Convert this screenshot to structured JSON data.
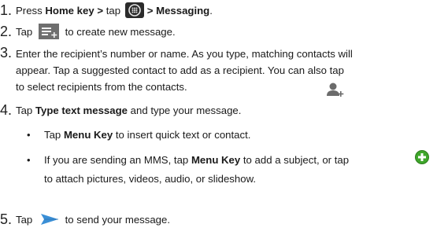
{
  "steps": [
    {
      "number": "1.",
      "parts": [
        "Press ",
        "Home key >",
        " tap ",
        "> Messaging",
        "."
      ]
    },
    {
      "number": "2.",
      "before": "Tap ",
      "after": " to create new message."
    },
    {
      "number": "3.",
      "lines": [
        "Enter the recipient’s number or name. As you type, matching contacts will",
        "appear. Tap a suggested contact to add as a recipient. You can also tap",
        "to select recipients from the contacts."
      ]
    },
    {
      "number": "4.",
      "before": "Tap ",
      "bold": "Type text message",
      "after": " and type your message."
    },
    {
      "number": "5.",
      "before": "Tap ",
      "after": " to send your message."
    }
  ],
  "bullets": [
    {
      "before": "Tap ",
      "bold": "Menu Key",
      "after": " to insert quick text or contact."
    },
    {
      "before": "If you are sending an MMS, tap ",
      "bold": "Menu Key",
      "after": " to add a subject, or tap",
      "line2": "to attach pictures, videos, audio, or slideshow."
    }
  ],
  "icons": {
    "apps": "apps-grid-icon",
    "compose": "compose-message-icon",
    "add_contact": "add-contact-icon",
    "attach": "attach-plus-icon",
    "send": "send-icon"
  },
  "colors": {
    "text": "#1a1a1a",
    "attach_green": "#3fa62b",
    "send_blue": "#3b8fd6",
    "compose_gray": "#6e6e6e"
  }
}
